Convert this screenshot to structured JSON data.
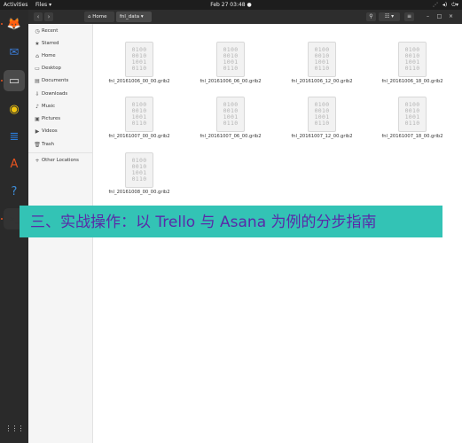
{
  "topbar": {
    "activities": "Activities",
    "app_menu": "Files ▾",
    "clock": "Feb 27  03:48  ●",
    "sys_icons": [
      "network-icon",
      "volume-icon",
      "power-icon"
    ]
  },
  "dock": {
    "items": [
      {
        "name": "firefox-icon",
        "glyph": "🦊"
      },
      {
        "name": "thunderbird-icon",
        "glyph": "✉"
      },
      {
        "name": "files-icon",
        "glyph": "▭"
      },
      {
        "name": "rhythmbox-icon",
        "glyph": "◉"
      },
      {
        "name": "writer-icon",
        "glyph": "≣"
      },
      {
        "name": "software-icon",
        "glyph": "A"
      },
      {
        "name": "help-icon",
        "glyph": "?"
      },
      {
        "name": "terminal-icon",
        "glyph": ">_"
      },
      {
        "name": "show-apps-icon",
        "glyph": "⋮⋮⋮"
      }
    ]
  },
  "header": {
    "back": "‹",
    "forward": "›",
    "home_crumb": "⌂ Home",
    "current_crumb": "fnl_data ▾",
    "search": "⚲",
    "view_list": "☷ ▾",
    "menu": "≡",
    "minimize": "–",
    "maximize": "□",
    "close": "×"
  },
  "sidebar": {
    "items": [
      {
        "icon": "◷",
        "label": "Recent"
      },
      {
        "icon": "★",
        "label": "Starred"
      },
      {
        "icon": "⌂",
        "label": "Home"
      },
      {
        "icon": "▭",
        "label": "Desktop"
      },
      {
        "icon": "▤",
        "label": "Documents"
      },
      {
        "icon": "⇩",
        "label": "Downloads"
      },
      {
        "icon": "♪",
        "label": "Music"
      },
      {
        "icon": "▣",
        "label": "Pictures"
      },
      {
        "icon": "▶",
        "label": "Videos"
      },
      {
        "icon": "🗑",
        "label": "Trash"
      },
      {
        "icon": "+",
        "label": "Other Locations"
      }
    ]
  },
  "files": {
    "thumb_text": [
      "0100",
      "0010",
      "1001",
      "0110"
    ],
    "items": [
      "fnl_20161006_00_00.grib2",
      "fnl_20161006_06_00.grib2",
      "fnl_20161006_12_00.grib2",
      "fnl_20161006_18_00.grib2",
      "fnl_20161007_00_00.grib2",
      "fnl_20161007_06_00.grib2",
      "fnl_20161007_12_00.grib2",
      "fnl_20161007_18_00.grib2",
      "fnl_20161008_00_00.grib2"
    ]
  },
  "banner": {
    "text": "三、实战操作：以 Trello 与 Asana 为例的分步指南"
  }
}
